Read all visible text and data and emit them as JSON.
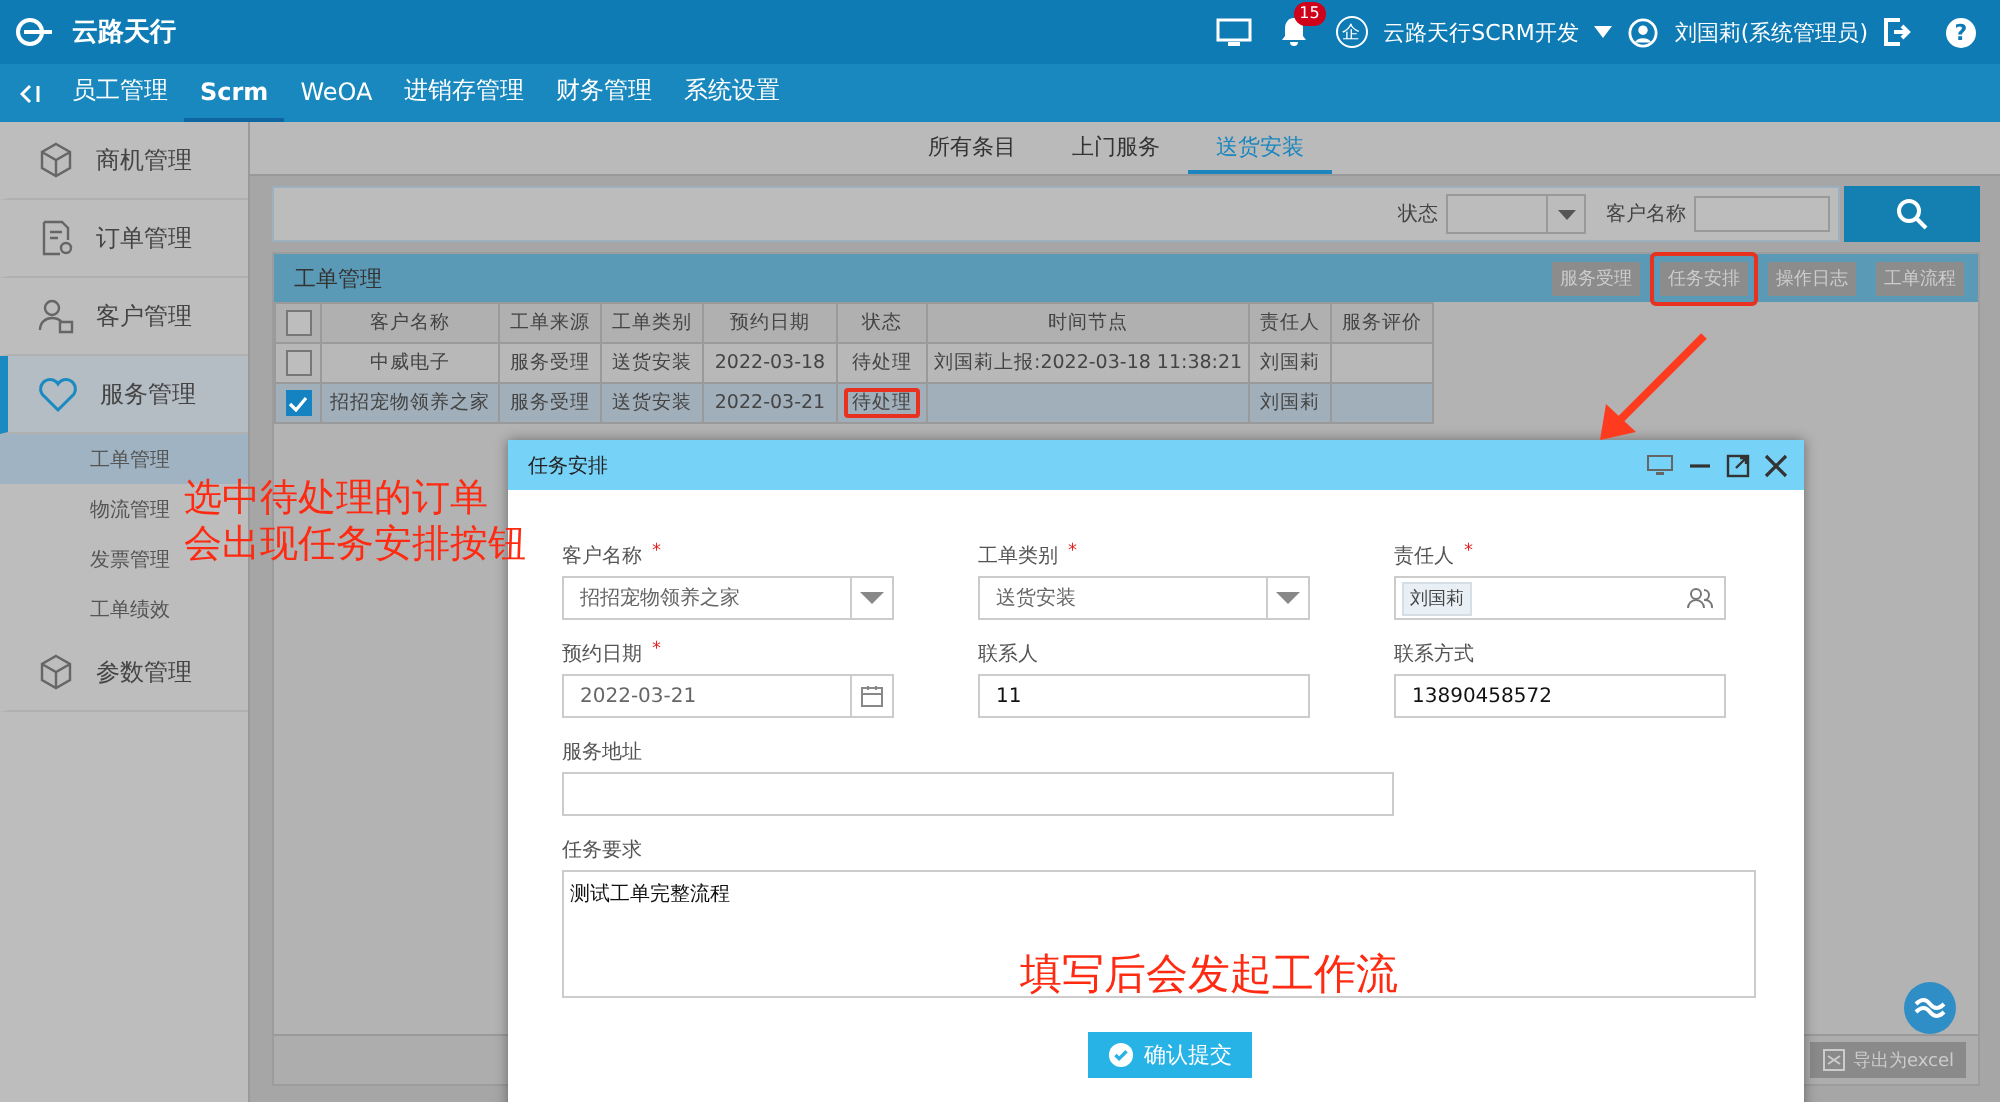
{
  "header": {
    "logo": "云路天行",
    "notification_count": "15",
    "company_mark": "企",
    "company": "云路天行SCRM开发",
    "user": "刘国莉(系统管理员)",
    "help": "?"
  },
  "nav_tabs": [
    {
      "label": "员工管理",
      "selected": false
    },
    {
      "label": "Scrm",
      "selected": true
    },
    {
      "label": "WeOA",
      "selected": false
    },
    {
      "label": "进销存管理",
      "selected": false
    },
    {
      "label": "财务管理",
      "selected": false
    },
    {
      "label": "系统设置",
      "selected": false
    }
  ],
  "sidebar": [
    {
      "label": "商机管理",
      "selected": false
    },
    {
      "label": "订单管理",
      "selected": false
    },
    {
      "label": "客户管理",
      "selected": false
    },
    {
      "label": "服务管理",
      "selected": true,
      "children": [
        {
          "label": "工单管理",
          "selected": true
        },
        {
          "label": "物流管理",
          "selected": false
        },
        {
          "label": "发票管理",
          "selected": false
        },
        {
          "label": "工单绩效",
          "selected": false
        }
      ]
    },
    {
      "label": "参数管理",
      "selected": false
    }
  ],
  "sub_tabs": [
    {
      "label": "所有条目",
      "selected": false
    },
    {
      "label": "上门服务",
      "selected": false
    },
    {
      "label": "送货安装",
      "selected": true
    }
  ],
  "filter": {
    "status_label": "状态",
    "customer_label": "客户名称"
  },
  "panel": {
    "title": "工单管理",
    "actions": [
      {
        "label": "服务受理",
        "highlighted": false
      },
      {
        "label": "任务安排",
        "highlighted": true
      },
      {
        "label": "操作日志",
        "highlighted": false
      },
      {
        "label": "工单流程",
        "highlighted": false
      }
    ],
    "select_all_checked": false,
    "columns": [
      "客户名称",
      "工单来源",
      "工单类别",
      "预约日期",
      "状态",
      "时间节点",
      "责任人",
      "服务评价"
    ],
    "rows": [
      {
        "checked": false,
        "customer": "中威电子",
        "source": "服务受理",
        "type": "送货安装",
        "date": "2022-03-18",
        "status": "待处理",
        "status_highlighted": false,
        "time_node": "刘国莉上报:2022-03-18 11:38:21",
        "owner": "刘国莉"
      },
      {
        "checked": true,
        "customer": "招招宠物领养之家",
        "source": "服务受理",
        "type": "送货安装",
        "date": "2022-03-21",
        "status": "待处理",
        "status_highlighted": true,
        "owner": "刘国莉"
      }
    ],
    "export": "导出为excel"
  },
  "dialog": {
    "title": "任务安排",
    "required_mark": "*",
    "fields": [
      {
        "kind": "select",
        "label": "客户名称",
        "required": true,
        "value": "招招宠物领养之家"
      },
      {
        "kind": "select",
        "label": "工单类别",
        "required": true,
        "value": "送货安装"
      },
      {
        "kind": "people",
        "label": "责任人",
        "required": true,
        "value": "刘国莉"
      },
      {
        "kind": "date",
        "label": "预约日期",
        "required": true,
        "value": "2022-03-21"
      },
      {
        "kind": "text",
        "label": "联系人",
        "required": false,
        "value": "11"
      },
      {
        "kind": "text",
        "label": "联系方式",
        "required": false,
        "value": "13890458572"
      },
      {
        "kind": "wide",
        "label": "服务地址",
        "required": false
      },
      {
        "kind": "textarea",
        "label": "任务要求",
        "required": false,
        "value": "测试工单完整流程"
      }
    ],
    "submit": "确认提交"
  },
  "annotations": [
    "选中待处理的订单",
    "会出现任务安排按钮",
    "填写后会发起工作流"
  ]
}
